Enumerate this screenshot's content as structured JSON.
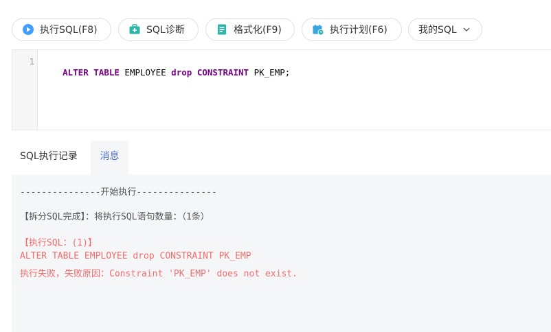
{
  "toolbar": {
    "run_label": "执行SQL(F8)",
    "diagnose_label": "SQL诊断",
    "format_label": "格式化(F9)",
    "plan_label": "执行计划(F6)",
    "mysql_label": "我的SQL",
    "icons": {
      "run": "play-circle-icon",
      "diagnose": "medical-kit-icon",
      "format": "document-icon",
      "plan": "calendar-icon",
      "mysql": "chevron-down-icon"
    },
    "colors": {
      "run": "#409eff",
      "diagnose": "#2bb5a8",
      "format": "#2bb5a8",
      "plan": "#3aa6e0"
    }
  },
  "editor": {
    "line_number": "1",
    "tokens": [
      {
        "text": "ALTER TABLE",
        "kind": "keyword"
      },
      {
        "text": " EMPLOYEE ",
        "kind": "plain"
      },
      {
        "text": "drop",
        "kind": "keyword"
      },
      {
        "text": " ",
        "kind": "plain"
      },
      {
        "text": "CONSTRAINT",
        "kind": "keyword"
      },
      {
        "text": " PK_EMP;",
        "kind": "plain"
      }
    ]
  },
  "tabs": {
    "history_label": "SQL执行记录",
    "message_label": "消息"
  },
  "messages": {
    "start_line": "---------------开始执行---------------",
    "split_line": "【拆分SQL完成】：将执行SQL语句数量：（1条）",
    "exec_header": "【执行SQL：(1)】",
    "sql_text": "ALTER TABLE EMPLOYEE drop CONSTRAINT PK_EMP",
    "error_text": "执行失败，失败原因：Constraint 'PK_EMP' does not exist."
  }
}
